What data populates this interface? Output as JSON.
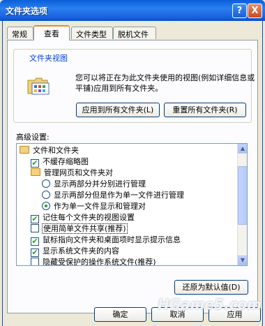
{
  "window": {
    "title": "文件夹选项",
    "help_button": "?",
    "close_button": "X"
  },
  "tabs": [
    {
      "label": "常规"
    },
    {
      "label": "查看"
    },
    {
      "label": "文件类型"
    },
    {
      "label": "脱机文件"
    }
  ],
  "folder_views": {
    "legend": "文件夹视图",
    "description": "您可以将正在为此文件夹使用的视图(例如详细信息或平铺)应用到所有文件夹。",
    "apply_all": "应用到所有文件夹(L)",
    "reset_all": "重置所有文件夹(R)"
  },
  "advanced": {
    "label": "高级设置:",
    "items": [
      {
        "text": "文件和文件夹"
      },
      {
        "text": "不缓存缩略图"
      },
      {
        "text": "管理网页和文件夹对"
      },
      {
        "text": "显示两部分并分别进行管理"
      },
      {
        "text": "显示两部分但是作为单一文件进行管理"
      },
      {
        "text": "作为单一文件显示和管理对"
      },
      {
        "text": "记住每个文件夹的视图设置"
      },
      {
        "text": "使用简单文件共享(推荐)"
      },
      {
        "text": "鼠标指向文件夹和桌面项时显示提示信息"
      },
      {
        "text": "显示系统文件夹的内容"
      },
      {
        "text": "隐藏受保护的操作系统文件(推荐)"
      }
    ],
    "restore_defaults": "还原为默认值(D)"
  },
  "footer": {
    "ok": "确定",
    "cancel": "取消",
    "apply": "应用"
  },
  "watermark": "HGame5.com",
  "check_mark": "✔",
  "icons": {
    "folder": "folder-icon",
    "scroll_up": "▲",
    "scroll_down": "▼"
  }
}
